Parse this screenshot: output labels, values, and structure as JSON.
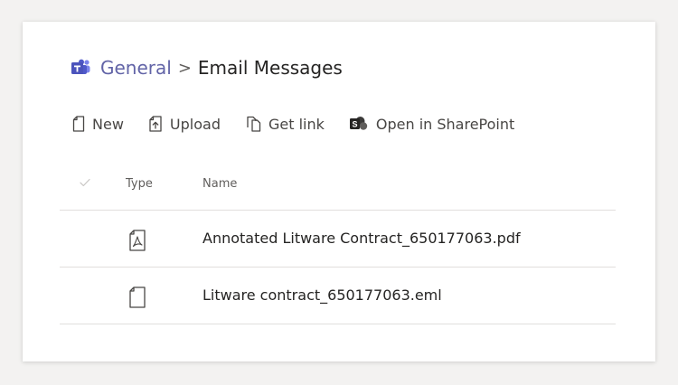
{
  "breadcrumb": {
    "icon": "teams-icon",
    "team": "General",
    "separator": ">",
    "current": "Email Messages"
  },
  "toolbar": {
    "new_label": "New",
    "upload_label": "Upload",
    "get_link_label": "Get link",
    "open_sharepoint_label": "Open in SharePoint"
  },
  "table": {
    "columns": {
      "check": "✓",
      "type": "Type",
      "name": "Name"
    },
    "rows": [
      {
        "type_icon": "pdf-file-icon",
        "name": "Annotated Litware Contract_650177063.pdf"
      },
      {
        "type_icon": "generic-file-icon",
        "name": "Litware contract_650177063.eml"
      }
    ]
  },
  "colors": {
    "accent": "#6264a7",
    "text": "#252423",
    "muted": "#605e5c",
    "divider": "#e1dfdd"
  }
}
